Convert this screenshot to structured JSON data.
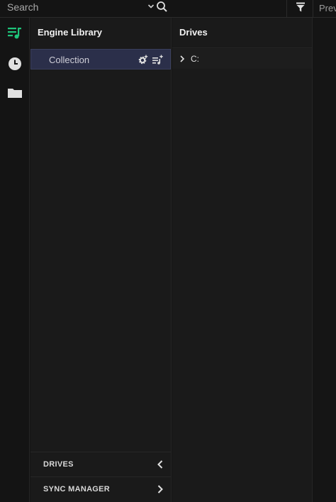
{
  "search": {
    "placeholder": "Search"
  },
  "preview": {
    "label": "Previ"
  },
  "rail": {
    "items": [
      {
        "name": "playlist-icon",
        "color": "#1ec47a",
        "active": true
      },
      {
        "name": "clock-icon",
        "active": false
      },
      {
        "name": "folder-icon",
        "active": false
      }
    ]
  },
  "library": {
    "title": "Engine Library",
    "collection_label": "Collection",
    "sections": [
      {
        "label": "DRIVES",
        "arrow": "chevron-left-icon"
      },
      {
        "label": "SYNC MANAGER",
        "arrow": "chevron-right-icon"
      }
    ]
  },
  "drives": {
    "title": "Drives",
    "items": [
      {
        "label": "C:"
      }
    ]
  },
  "colors": {
    "accent": "#1ec47a",
    "selected_row": "#2b2f4a",
    "panel_bg": "#1a1a1a"
  }
}
